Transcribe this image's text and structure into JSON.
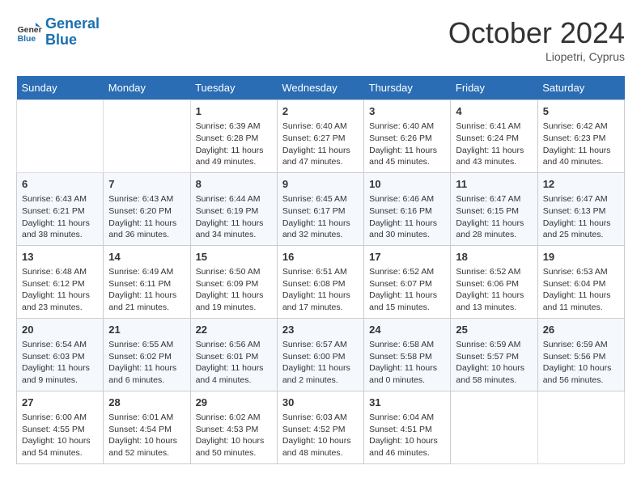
{
  "header": {
    "logo_line1": "General",
    "logo_line2": "Blue",
    "month": "October 2024",
    "location": "Liopetri, Cyprus"
  },
  "weekdays": [
    "Sunday",
    "Monday",
    "Tuesday",
    "Wednesday",
    "Thursday",
    "Friday",
    "Saturday"
  ],
  "weeks": [
    [
      {
        "day": "",
        "info": ""
      },
      {
        "day": "",
        "info": ""
      },
      {
        "day": "1",
        "info": "Sunrise: 6:39 AM\nSunset: 6:28 PM\nDaylight: 11 hours and 49 minutes."
      },
      {
        "day": "2",
        "info": "Sunrise: 6:40 AM\nSunset: 6:27 PM\nDaylight: 11 hours and 47 minutes."
      },
      {
        "day": "3",
        "info": "Sunrise: 6:40 AM\nSunset: 6:26 PM\nDaylight: 11 hours and 45 minutes."
      },
      {
        "day": "4",
        "info": "Sunrise: 6:41 AM\nSunset: 6:24 PM\nDaylight: 11 hours and 43 minutes."
      },
      {
        "day": "5",
        "info": "Sunrise: 6:42 AM\nSunset: 6:23 PM\nDaylight: 11 hours and 40 minutes."
      }
    ],
    [
      {
        "day": "6",
        "info": "Sunrise: 6:43 AM\nSunset: 6:21 PM\nDaylight: 11 hours and 38 minutes."
      },
      {
        "day": "7",
        "info": "Sunrise: 6:43 AM\nSunset: 6:20 PM\nDaylight: 11 hours and 36 minutes."
      },
      {
        "day": "8",
        "info": "Sunrise: 6:44 AM\nSunset: 6:19 PM\nDaylight: 11 hours and 34 minutes."
      },
      {
        "day": "9",
        "info": "Sunrise: 6:45 AM\nSunset: 6:17 PM\nDaylight: 11 hours and 32 minutes."
      },
      {
        "day": "10",
        "info": "Sunrise: 6:46 AM\nSunset: 6:16 PM\nDaylight: 11 hours and 30 minutes."
      },
      {
        "day": "11",
        "info": "Sunrise: 6:47 AM\nSunset: 6:15 PM\nDaylight: 11 hours and 28 minutes."
      },
      {
        "day": "12",
        "info": "Sunrise: 6:47 AM\nSunset: 6:13 PM\nDaylight: 11 hours and 25 minutes."
      }
    ],
    [
      {
        "day": "13",
        "info": "Sunrise: 6:48 AM\nSunset: 6:12 PM\nDaylight: 11 hours and 23 minutes."
      },
      {
        "day": "14",
        "info": "Sunrise: 6:49 AM\nSunset: 6:11 PM\nDaylight: 11 hours and 21 minutes."
      },
      {
        "day": "15",
        "info": "Sunrise: 6:50 AM\nSunset: 6:09 PM\nDaylight: 11 hours and 19 minutes."
      },
      {
        "day": "16",
        "info": "Sunrise: 6:51 AM\nSunset: 6:08 PM\nDaylight: 11 hours and 17 minutes."
      },
      {
        "day": "17",
        "info": "Sunrise: 6:52 AM\nSunset: 6:07 PM\nDaylight: 11 hours and 15 minutes."
      },
      {
        "day": "18",
        "info": "Sunrise: 6:52 AM\nSunset: 6:06 PM\nDaylight: 11 hours and 13 minutes."
      },
      {
        "day": "19",
        "info": "Sunrise: 6:53 AM\nSunset: 6:04 PM\nDaylight: 11 hours and 11 minutes."
      }
    ],
    [
      {
        "day": "20",
        "info": "Sunrise: 6:54 AM\nSunset: 6:03 PM\nDaylight: 11 hours and 9 minutes."
      },
      {
        "day": "21",
        "info": "Sunrise: 6:55 AM\nSunset: 6:02 PM\nDaylight: 11 hours and 6 minutes."
      },
      {
        "day": "22",
        "info": "Sunrise: 6:56 AM\nSunset: 6:01 PM\nDaylight: 11 hours and 4 minutes."
      },
      {
        "day": "23",
        "info": "Sunrise: 6:57 AM\nSunset: 6:00 PM\nDaylight: 11 hours and 2 minutes."
      },
      {
        "day": "24",
        "info": "Sunrise: 6:58 AM\nSunset: 5:58 PM\nDaylight: 11 hours and 0 minutes."
      },
      {
        "day": "25",
        "info": "Sunrise: 6:59 AM\nSunset: 5:57 PM\nDaylight: 10 hours and 58 minutes."
      },
      {
        "day": "26",
        "info": "Sunrise: 6:59 AM\nSunset: 5:56 PM\nDaylight: 10 hours and 56 minutes."
      }
    ],
    [
      {
        "day": "27",
        "info": "Sunrise: 6:00 AM\nSunset: 4:55 PM\nDaylight: 10 hours and 54 minutes."
      },
      {
        "day": "28",
        "info": "Sunrise: 6:01 AM\nSunset: 4:54 PM\nDaylight: 10 hours and 52 minutes."
      },
      {
        "day": "29",
        "info": "Sunrise: 6:02 AM\nSunset: 4:53 PM\nDaylight: 10 hours and 50 minutes."
      },
      {
        "day": "30",
        "info": "Sunrise: 6:03 AM\nSunset: 4:52 PM\nDaylight: 10 hours and 48 minutes."
      },
      {
        "day": "31",
        "info": "Sunrise: 6:04 AM\nSunset: 4:51 PM\nDaylight: 10 hours and 46 minutes."
      },
      {
        "day": "",
        "info": ""
      },
      {
        "day": "",
        "info": ""
      }
    ]
  ]
}
